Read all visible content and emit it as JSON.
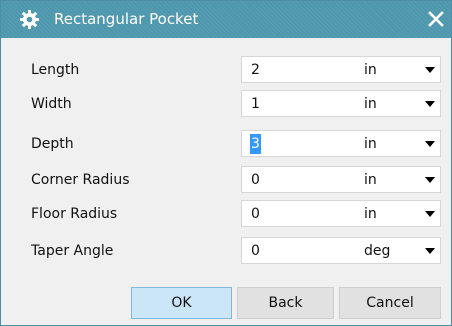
{
  "dialog": {
    "title": "Rectangular Pocket",
    "title_icon": "gear-icon",
    "close_icon": "close-icon"
  },
  "fields": [
    {
      "label": "Length",
      "value": "2",
      "unit": "in"
    },
    {
      "label": "Width",
      "value": "1",
      "unit": "in"
    },
    {
      "label": "Depth",
      "value": "3",
      "unit": "in"
    },
    {
      "label": "Corner Radius",
      "value": "0",
      "unit": "in"
    },
    {
      "label": "Floor Radius",
      "value": "0",
      "unit": "in"
    },
    {
      "label": "Taper Angle",
      "value": "0",
      "unit": "deg"
    }
  ],
  "buttons": {
    "ok": "OK",
    "back": "Back",
    "cancel": "Cancel"
  },
  "colors": {
    "titlebar": "#4e97ad",
    "selection": "#3399ff",
    "ok_button": "#cbe6f7"
  }
}
